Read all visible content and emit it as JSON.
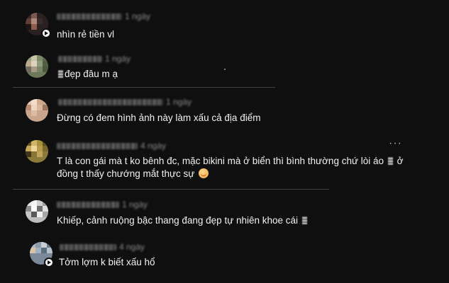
{
  "comments": [
    {
      "text": "nhìn rẻ tiền vl"
    },
    {
      "text": "đẹp đâu m ạ"
    },
    {
      "text": "Đừng có đem hình ảnh này làm xấu cả địa điểm"
    },
    {
      "text_line1": "T là con gái mà t ko bênh đc, mặc bikini mà ở biển thì bình thường chứ lòi áo",
      "text_line1_tail": "ở",
      "text_line2": "đồng t thấy chướng mắt thực sự"
    },
    {
      "text": "Khiếp, cảnh ruộng bậc thang đang đẹp tự nhiên khoe cái"
    },
    {
      "text": "Tởm lợm k biết xấu hổ"
    }
  ],
  "more_label": "···",
  "colors": {
    "background": "#0f0f0f",
    "text": "#f1f1f1",
    "separator": "#3d3d3d"
  }
}
